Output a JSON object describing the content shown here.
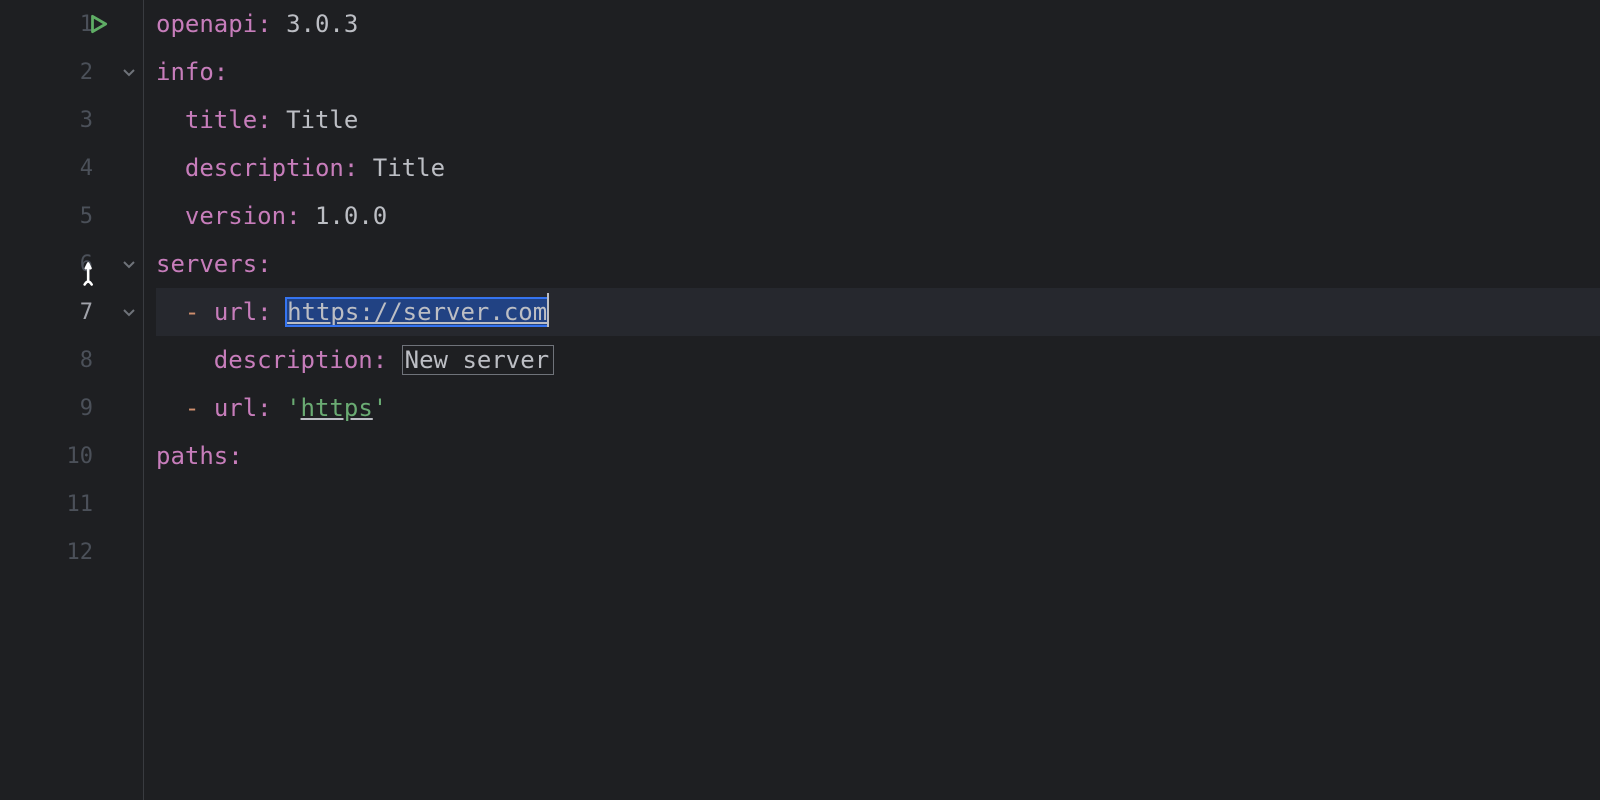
{
  "gutter": {
    "lines": [
      "1",
      "2",
      "3",
      "4",
      "5",
      "6",
      "7",
      "8",
      "9",
      "10",
      "11",
      "12"
    ],
    "currentLine": 7,
    "foldLines": [
      2,
      6,
      7
    ]
  },
  "code": {
    "l1": {
      "key": "openapi",
      "val": "3.0.3"
    },
    "l2": {
      "key": "info"
    },
    "l3": {
      "key": "title",
      "val": "Title"
    },
    "l4": {
      "key": "description",
      "val": "Title"
    },
    "l5": {
      "key": "version",
      "val": "1.0.0"
    },
    "l6": {
      "key": "servers"
    },
    "l7": {
      "dash": "-",
      "key": "url",
      "val": "https://server.com"
    },
    "l8": {
      "key": "description",
      "val": "New server"
    },
    "l9": {
      "dash": "-",
      "key": "url",
      "q1": "'",
      "val": "https",
      "q2": "'"
    },
    "l10": {
      "key": "paths"
    }
  }
}
